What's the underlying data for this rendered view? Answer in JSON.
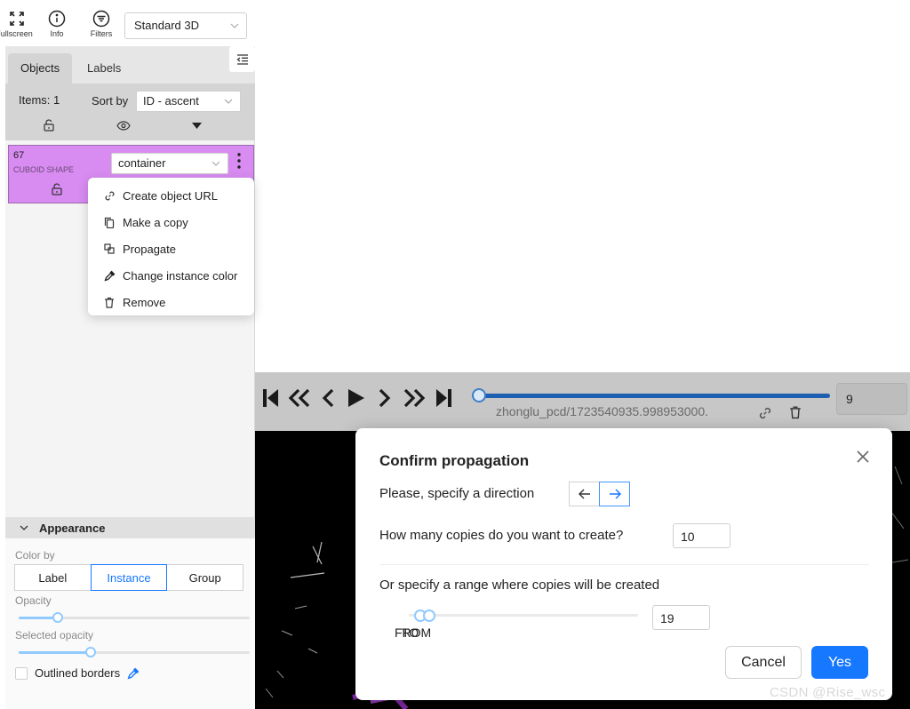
{
  "toolbar": {
    "fullscreen_label": "Fullscreen",
    "info_label": "Info",
    "filters_label": "Filters",
    "view_select_value": "Standard 3D"
  },
  "sidebar": {
    "tabs": [
      {
        "label": "Objects"
      },
      {
        "label": "Labels"
      }
    ],
    "items_count": "Items: 1",
    "sort_label": "Sort by",
    "sort_value": "ID - ascent"
  },
  "object": {
    "id": "67",
    "type": "CUBOID SHAPE",
    "label_value": "container",
    "color": "#d88bf1"
  },
  "context_menu": {
    "items": [
      {
        "label": "Create object URL",
        "icon": "link-icon"
      },
      {
        "label": "Make a copy",
        "icon": "copy-icon"
      },
      {
        "label": "Propagate",
        "icon": "propagate-icon"
      },
      {
        "label": "Change instance color",
        "icon": "color-picker-icon"
      },
      {
        "label": "Remove",
        "icon": "trash-icon"
      }
    ]
  },
  "appearance": {
    "title": "Appearance",
    "color_by_label": "Color by",
    "color_by_options": [
      "Label",
      "Instance",
      "Group"
    ],
    "color_by_selected": "Instance",
    "opacity_label": "Opacity",
    "opacity_value": 0.17,
    "selected_opacity_label": "Selected opacity",
    "selected_opacity_value": 0.31,
    "outlined_borders_label": "Outlined borders"
  },
  "player": {
    "file_name": "zhonglu_pcd/1723540935.998953000.",
    "frame_value": "9",
    "frame_position": 0.0
  },
  "modal": {
    "title": "Confirm propagation",
    "direction_label": "Please, specify a direction",
    "direction_selected": "forward",
    "copies_label": "How many copies do you want to create?",
    "copies_value": "10",
    "range_label": "Or specify a range where copies will be created",
    "range_from_label": "FROM",
    "range_to_label": "TO",
    "range_from_position": 0.05,
    "range_to_position": 0.09,
    "range_value": "19",
    "cancel_label": "Cancel",
    "yes_label": "Yes"
  },
  "watermark": "CSDN @Rise_wsc",
  "colors": {
    "accent": "#1677ff",
    "object_color": "#d88bf1",
    "player_bar": "#c7c7c7",
    "slider_track": "#1d5fb0"
  }
}
